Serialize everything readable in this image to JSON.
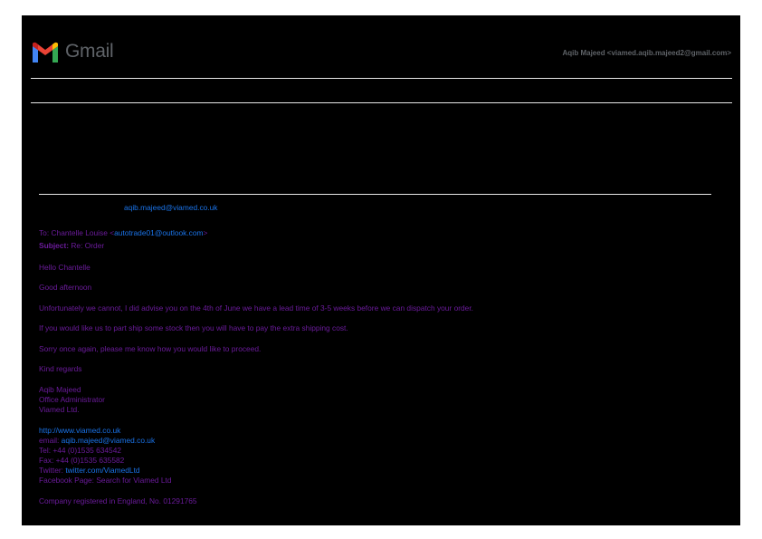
{
  "header": {
    "logo_text": "Gmail",
    "account": "Aqib Majeed <viamed.aqib.majeed2@gmail.com>"
  },
  "message": {
    "from_email": "aqib.majeed@viamed.co.uk",
    "to_label": "To: Chantelle Louise <",
    "to_email": "autotrade01@outlook.com",
    "to_suffix": ">",
    "subject_label": "Subject:",
    "subject": "Re: Order",
    "body": [
      "Hello Chantelle",
      "Good afternoon",
      "Unfortunately we cannot, I did advise you on the 4th of June we have a lead time of 3-5 weeks before we can dispatch your order.",
      "If you would like us to part ship some stock then you will have to pay the extra shipping cost.",
      "Sorry once again, please me know how you would like to proceed.",
      "Kind regards"
    ],
    "signature": {
      "name": "Aqib Majeed",
      "role": "Office Administrator",
      "company": "Viamed Ltd.",
      "website": "http://www.viamed.co.uk",
      "email_label": "email:",
      "email": "aqib.majeed@viamed.co.uk",
      "tel": "Tel: +44 (0)1535 634542",
      "fax": "Fax: +44 (0)1535 635582",
      "twitter_label": "Twitter:",
      "twitter": "twitter.com/ViamedLtd",
      "facebook": "Facebook Page: Search for Viamed Ltd",
      "registration": "Company registered in England, No. 01291765"
    }
  },
  "colors": {
    "page_background": "#000000",
    "text": "#6a1b9a",
    "link": "#1a73e8",
    "muted": "#5f6368"
  }
}
